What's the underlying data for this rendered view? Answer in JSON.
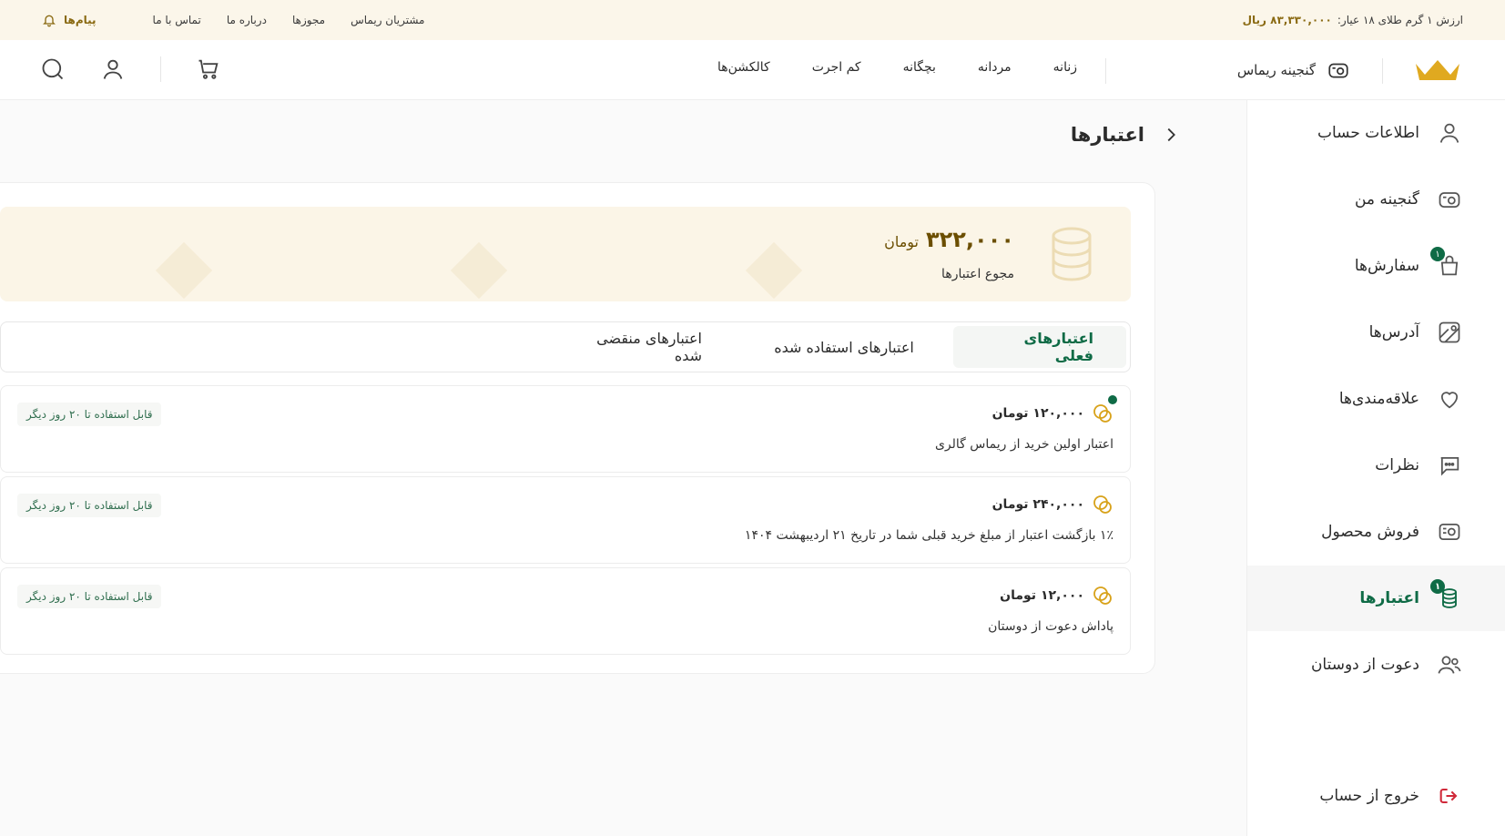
{
  "topbar": {
    "gold_label": "ارزش ۱ گرم طلای ۱۸ عیار:",
    "gold_value": "۸۳,۳۳۰,۰۰۰ ریال",
    "links": [
      "مشتریان ریماس",
      "مجوزها",
      "درباره ما",
      "تماس با ما"
    ],
    "messages_label": "پیام‌ها"
  },
  "header": {
    "treasure_label": "گنجینه ریماس",
    "nav": [
      "زنانه",
      "مردانه",
      "بچگانه",
      "کم اجرت",
      "کالکشن‌ها"
    ],
    "icons": [
      "search-icon",
      "user-icon",
      "cart-icon"
    ]
  },
  "sidebar": {
    "items": [
      {
        "label": "اطلاعات حساب",
        "icon": "user-icon"
      },
      {
        "label": "گنجینه من",
        "icon": "treasure-icon"
      },
      {
        "label": "سفارش‌ها",
        "icon": "bag-icon",
        "badge": "۱"
      },
      {
        "label": "آدرس‌ها",
        "icon": "map-icon"
      },
      {
        "label": "علاقه‌مندی‌ها",
        "icon": "heart-icon"
      },
      {
        "label": "نظرات",
        "icon": "comment-icon"
      },
      {
        "label": "فروش محصول",
        "icon": "sell-icon"
      },
      {
        "label": "اعتبارها",
        "icon": "coins-icon",
        "badge": "۱",
        "active": true
      },
      {
        "label": "دعوت از دوستان",
        "icon": "users-icon"
      }
    ],
    "logout_label": "خروج از حساب"
  },
  "page": {
    "title": "اعتبارها"
  },
  "summary": {
    "amount": "۳۲۲,۰۰۰",
    "unit": "تومان",
    "label": "مجوع اعتبارها"
  },
  "tabs": [
    {
      "label": "اعتبارهای فعلی",
      "active": true
    },
    {
      "label": "اعتبارهای استفاده شده"
    },
    {
      "label": "اعتبارهای منقضی شده"
    }
  ],
  "credits": [
    {
      "amount": "۱۲۰,۰۰۰ تومان",
      "desc": "اعتبار اولین خرید از ریماس گالری",
      "badge": "قابل استفاده تا ۲۰ روز دیگر",
      "new": true
    },
    {
      "amount": "۲۴۰,۰۰۰ تومان",
      "desc": "۱٪ بازگشت اعتبار از مبلغ خرید قبلی شما در تاریخ ۲۱ اردیبهشت ۱۴۰۴",
      "badge": "قابل استفاده تا ۲۰ روز دیگر"
    },
    {
      "amount": "۱۲,۰۰۰ تومان",
      "desc": "پاداش دعوت از دوستان",
      "badge": "قابل استفاده تا ۲۰ روز دیگر"
    }
  ],
  "colors": {
    "accent": "#0f6b46",
    "gold": "#d8a21a",
    "topbar_bg": "#fbf6ea"
  }
}
